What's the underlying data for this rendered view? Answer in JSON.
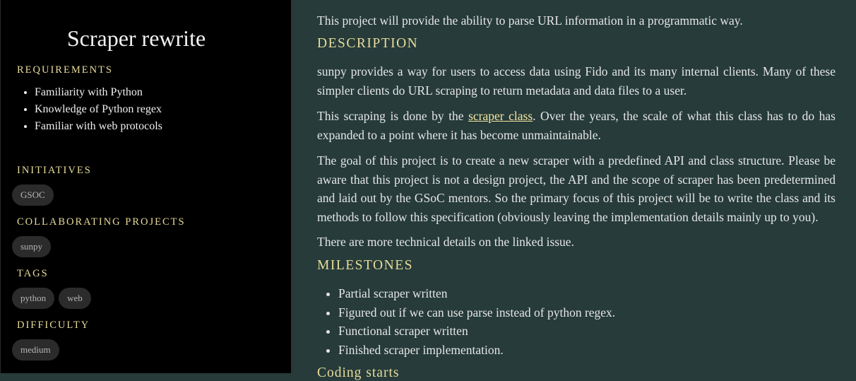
{
  "sidebar": {
    "title": "Scraper rewrite",
    "requirements_heading": "REQUIREMENTS",
    "requirements": [
      "Familiarity with Python",
      "Knowledge of Python regex",
      "Familiar with web protocols"
    ],
    "initiatives_heading": "INITIATIVES",
    "initiatives": [
      "GSOC"
    ],
    "collaborating_heading": "COLLABORATING PROJECTS",
    "collaborating": [
      "sunpy"
    ],
    "tags_heading": "TAGS",
    "tags": [
      "python",
      "web"
    ],
    "difficulty_heading": "DIFFICULTY",
    "difficulty": [
      "medium"
    ]
  },
  "main": {
    "intro": "This project will provide the ability to parse URL information in a programmatic way.",
    "description_heading": "DESCRIPTION",
    "para1": "sunpy provides a way for users to access data using Fido and its many internal clients. Many of these simpler clients do URL scraping to return metadata and data files to a user.",
    "para2_before": "This scraping is done by the ",
    "para2_link": "scraper class",
    "para2_after": ". Over the years, the scale of what this class has to do has expanded to a point where it has become unmaintainable.",
    "para3": "The goal of this project is to create a new scraper with a predefined API and class structure. Please be aware that this project is not a design project, the API and the scope of scraper has been predetermined and laid out by the GSoC mentors. So the primary focus of this project will be to write the class and its methods to follow this specification (obviously leaving the implementation details mainly up to you).",
    "para4": "There are more technical details on the linked issue.",
    "milestones_heading": "MILESTONES",
    "milestones": [
      "Partial scraper written",
      "Figured out if we can use parse instead of python regex.",
      "Functional scraper written",
      "Finished scraper implementation."
    ],
    "coding_heading": "Coding starts"
  },
  "colors": {
    "sidebar_bg": "#000000",
    "main_bg": "#263b3a",
    "heading_accent": "#e8dc9a",
    "pill_bg": "#2b2b2b"
  }
}
